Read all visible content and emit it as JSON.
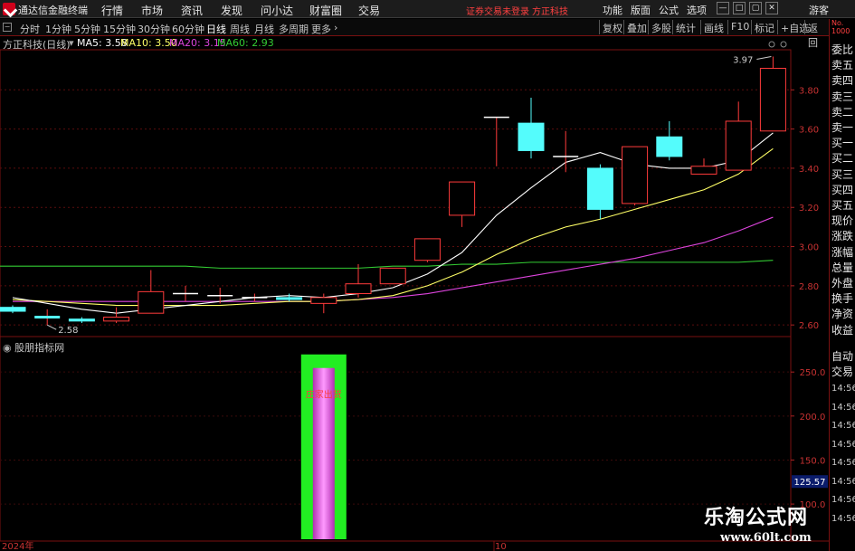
{
  "app": {
    "name": "通达信金融终端"
  },
  "menu": [
    "行情",
    "市场",
    "资讯",
    "发现",
    "问小达",
    "财富圈",
    "交易"
  ],
  "status": {
    "trade": "证券交易未登录",
    "stock": "方正科技"
  },
  "top_right": {
    "items": [
      "功能",
      "版面",
      "公式",
      "选项"
    ],
    "guest": "游客"
  },
  "periods": [
    "分时",
    "1分钟",
    "5分钟",
    "15分钟",
    "30分钟",
    "60分钟",
    "日线",
    "周线",
    "月线",
    "多周期",
    "更多"
  ],
  "active_period": "日线",
  "more_arrow": "›",
  "toolbar_right": [
    "复权",
    "叠加",
    "多股",
    "统计",
    "画线",
    "F10",
    "标记",
    "+自选",
    "返回"
  ],
  "info": {
    "title": "方正科技(日线)",
    "ma": [
      {
        "label": "MA5: 3.58",
        "color": "#ffffff"
      },
      {
        "label": "MA10: 3.50",
        "color": "#ffff66"
      },
      {
        "label": "MA20: 3.15",
        "color": "#dd44dd"
      },
      {
        "label": "MA60: 2.93",
        "color": "#33cc33"
      }
    ]
  },
  "price_axis": [
    "3.80",
    "3.60",
    "3.40",
    "3.20",
    "3.00",
    "2.80",
    "2.60"
  ],
  "annotations": {
    "high": "3.97",
    "low": "2.58"
  },
  "sub": {
    "title": "股朋指标网",
    "signal_text": "庄家出货",
    "axis": [
      "250.0",
      "200.0",
      "150.0",
      "100.0"
    ],
    "current": "125.57"
  },
  "date_axis": {
    "left": "2024年",
    "mid": "10"
  },
  "right_panel": {
    "header": "No. 1000",
    "items": [
      "委比",
      "卖五",
      "卖四",
      "卖三",
      "卖二",
      "卖一",
      "买一",
      "买二",
      "买三",
      "买四",
      "买五",
      "现价",
      "涨跌",
      "涨幅",
      "总量",
      "外盘",
      "换手",
      "净资",
      "收益"
    ],
    "lower_items": [
      "自动",
      "交易"
    ],
    "times": [
      "14:56",
      "14:56",
      "14:56",
      "14:56",
      "14:56",
      "14:56",
      "14:56",
      "14:56"
    ]
  },
  "watermark": {
    "cn": "乐淘公式网",
    "url": "www.60lt.com"
  },
  "colors": {
    "up": "#ff3b3b",
    "down": "#54fcfc",
    "ma5": "#ffffff",
    "ma10": "#ffff66",
    "ma20": "#dd44dd",
    "ma60": "#33cc33",
    "signal_outer": "#22ee22",
    "signal_inner": "#ff66ff"
  },
  "chart_data": {
    "type": "candlestick",
    "price_range": [
      2.55,
      4.0
    ],
    "candles": [
      {
        "o": 2.69,
        "c": 2.67,
        "h": 2.7,
        "l": 2.66
      },
      {
        "o": 2.64,
        "c": 2.64,
        "h": 2.68,
        "l": 2.6
      },
      {
        "o": 2.63,
        "c": 2.62,
        "h": 2.64,
        "l": 2.61
      },
      {
        "o": 2.62,
        "c": 2.64,
        "h": 2.69,
        "l": 2.61
      },
      {
        "o": 2.66,
        "c": 2.77,
        "h": 2.88,
        "l": 2.66
      },
      {
        "o": 2.76,
        "c": 2.76,
        "h": 2.8,
        "l": 2.72
      },
      {
        "o": 2.75,
        "c": 2.75,
        "h": 2.79,
        "l": 2.71
      },
      {
        "o": 2.74,
        "c": 2.74,
        "h": 2.76,
        "l": 2.72
      },
      {
        "o": 2.74,
        "c": 2.73,
        "h": 2.76,
        "l": 2.72
      },
      {
        "o": 2.71,
        "c": 2.74,
        "h": 2.76,
        "l": 2.66
      },
      {
        "o": 2.76,
        "c": 2.81,
        "h": 2.91,
        "l": 2.74
      },
      {
        "o": 2.81,
        "c": 2.89,
        "h": 2.89,
        "l": 2.81
      },
      {
        "o": 2.93,
        "c": 3.04,
        "h": 3.04,
        "l": 2.92
      },
      {
        "o": 3.16,
        "c": 3.33,
        "h": 3.33,
        "l": 3.1
      },
      {
        "o": 3.66,
        "c": 3.66,
        "h": 3.66,
        "l": 3.41
      },
      {
        "o": 3.63,
        "c": 3.49,
        "h": 3.76,
        "l": 3.45
      },
      {
        "o": 3.46,
        "c": 3.46,
        "h": 3.59,
        "l": 3.38
      },
      {
        "o": 3.4,
        "c": 3.19,
        "h": 3.42,
        "l": 3.14
      },
      {
        "o": 3.22,
        "c": 3.51,
        "h": 3.51,
        "l": 3.21
      },
      {
        "o": 3.56,
        "c": 3.46,
        "h": 3.64,
        "l": 3.44
      },
      {
        "o": 3.37,
        "c": 3.41,
        "h": 3.45,
        "l": 3.37
      },
      {
        "o": 3.39,
        "c": 3.64,
        "h": 3.74,
        "l": 3.39
      },
      {
        "o": 3.59,
        "c": 3.91,
        "h": 3.97,
        "l": 3.59
      }
    ],
    "ma5": [
      2.74,
      2.71,
      2.68,
      2.66,
      2.68,
      2.7,
      2.72,
      2.74,
      2.75,
      2.74,
      2.76,
      2.79,
      2.86,
      2.97,
      3.16,
      3.3,
      3.43,
      3.48,
      3.42,
      3.4,
      3.4,
      3.44,
      3.58
    ],
    "ma10": [
      2.73,
      2.72,
      2.71,
      2.7,
      2.7,
      2.7,
      2.7,
      2.71,
      2.72,
      2.72,
      2.73,
      2.75,
      2.8,
      2.87,
      2.96,
      3.04,
      3.1,
      3.14,
      3.19,
      3.24,
      3.29,
      3.37,
      3.5
    ],
    "ma20": [
      2.72,
      2.72,
      2.72,
      2.72,
      2.72,
      2.72,
      2.72,
      2.72,
      2.72,
      2.72,
      2.73,
      2.74,
      2.76,
      2.79,
      2.82,
      2.85,
      2.88,
      2.91,
      2.94,
      2.98,
      3.02,
      3.08,
      3.15
    ],
    "ma60": [
      2.9,
      2.9,
      2.9,
      2.9,
      2.9,
      2.9,
      2.89,
      2.89,
      2.89,
      2.89,
      2.89,
      2.9,
      2.9,
      2.91,
      2.91,
      2.92,
      2.92,
      2.92,
      2.92,
      2.92,
      2.92,
      2.92,
      2.93
    ],
    "signal_index": 9,
    "sub_range": [
      60,
      280
    ],
    "signal_value": 270
  }
}
